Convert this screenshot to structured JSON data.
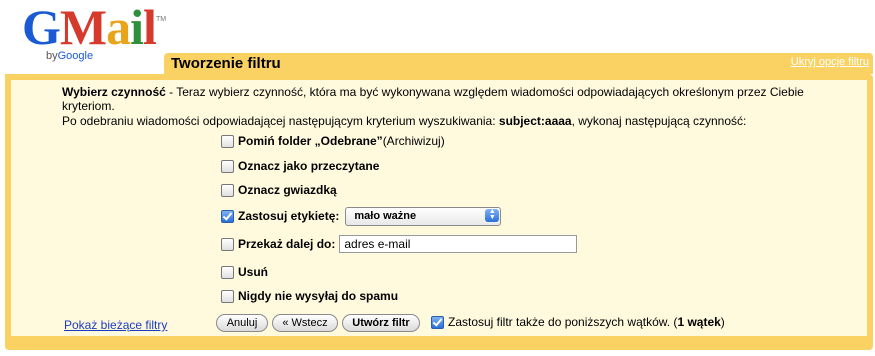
{
  "logo": {
    "gm": "G",
    "m": "M",
    "a": "a",
    "i": "i",
    "l": "l",
    "by": "by",
    "google": "Google",
    "tm": "TM"
  },
  "header": {
    "title": "Tworzenie filtru",
    "hide_link": "Ukryj opcje filtru"
  },
  "description": {
    "label": "Wybierz czynność",
    "text": " - Teraz wybierz czynność, która ma być wykonywana względem wiadomości odpowiadających określonym przez Ciebie kryteriom.",
    "line2_pre": "Po odebraniu wiadomości odpowiadającej następującym kryterium wyszukiwania: ",
    "criterion": "subject:aaaa",
    "line2_post": ", wykonaj następującą czynność:"
  },
  "options": {
    "skip_inbox": {
      "label": "Pomiń folder „Odebrane”",
      "suffix": " (Archiwizuj)",
      "checked": false
    },
    "mark_read": {
      "label": "Oznacz jako przeczytane",
      "checked": false
    },
    "star": {
      "label": "Oznacz gwiazdką",
      "checked": false
    },
    "apply_label": {
      "label": "Zastosuj etykietę:",
      "checked": true,
      "selected_value": "mało ważne"
    },
    "forward": {
      "label": "Przekaż dalej do:",
      "checked": false,
      "value": "adres e-mail"
    },
    "delete": {
      "label": "Usuń",
      "checked": false
    },
    "never_spam": {
      "label": "Nigdy nie wysyłaj do spamu",
      "checked": false
    }
  },
  "footer": {
    "show_filters": "Pokaż bieżące filtry",
    "cancel": "Anuluj",
    "back": "« Wstecz",
    "create": "Utwórz filtr",
    "apply_also": "Zastosuj filtr także do poniższych wątków. (",
    "thread_count": "1 wątek",
    "apply_also_end": ")"
  }
}
